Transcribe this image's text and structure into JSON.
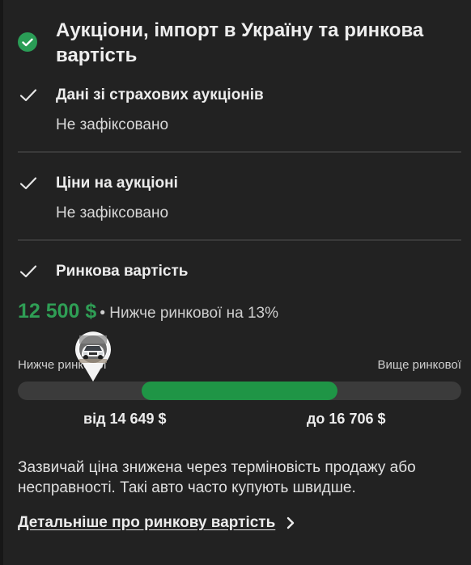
{
  "header": {
    "title": "Аукціони, імпорт в Україну та ринкова вартість"
  },
  "sections": [
    {
      "title": "Дані зі страхових аукціонів",
      "value": "Не зафіксовано"
    },
    {
      "title": "Ціни на аукціоні",
      "value": "Не зафіксовано"
    },
    {
      "title": "Ринкова вартість"
    }
  ],
  "market": {
    "price": "12 500 $",
    "note": "• Нижче ринкової на 13%",
    "label_below": "Нижче ринкової",
    "label_above": "Вище ринкової",
    "range_from": "від 14 649 $",
    "range_to": "до 16 706 $",
    "range_start_fraction": 0.28,
    "range_end_fraction": 0.72,
    "marker_fraction": 0.17
  },
  "info_text": "Зазвичай ціна знижена через терміновість продажу або несправності. Такі авто часто купують швидше.",
  "link": {
    "label": "Детальніше про ринкову вартість"
  },
  "colors": {
    "background": "#222222",
    "accent_green": "#2f9e55",
    "bar_fill": "#1f9546",
    "track": "#3b3b3b"
  },
  "icons": [
    "check-circle-icon",
    "check-icon",
    "car-pin-icon",
    "chevron-right-icon"
  ]
}
